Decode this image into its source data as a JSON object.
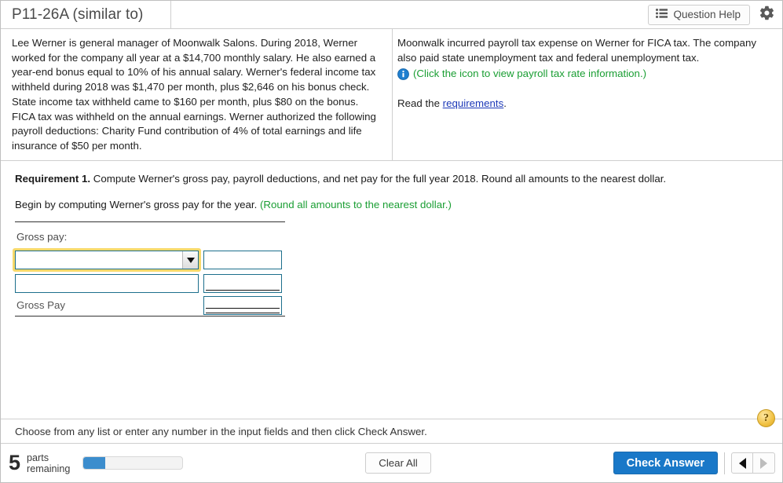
{
  "header": {
    "title": "P11-26A (similar to)",
    "question_help_label": "Question Help",
    "list_icon": "list-icon",
    "gear_icon": "gear-icon"
  },
  "problem": {
    "left_text": "Lee Werner is general manager of Moonwalk Salons. During 2018, Werner worked for the company all year at a $14,700 monthly salary. He also earned a year-end bonus equal to 10% of his annual salary. Werner's federal income tax withheld during 2018 was $1,470 per month, plus $2,646 on his bonus check. State income tax withheld came to $160 per month, plus $80 on the bonus. FICA tax was withheld on the annual earnings. Werner authorized the following payroll deductions: Charity Fund contribution of 4% of total earnings and life insurance of $50 per month.",
    "right_text": "Moonwalk incurred payroll tax expense on Werner for FICA tax. The company also paid state unemployment tax and federal unemployment tax.",
    "info_icon": "info-icon",
    "info_note": "(Click the icon to view payroll tax rate information.)",
    "read_prefix": "Read the ",
    "read_link": "requirements",
    "read_suffix": "."
  },
  "requirement": {
    "label": "Requirement 1.",
    "text": " Compute Werner's gross pay, payroll deductions, and net pay for the full year 2018. Round all amounts to the nearest dollar.",
    "begin_text": "Begin by computing Werner's gross pay for the year. ",
    "begin_note": "(Round all amounts to the nearest dollar.)"
  },
  "answer_table": {
    "caption": "Gross pay:",
    "rows": [
      {
        "type": "select",
        "value": "",
        "amount": "",
        "underline": "none"
      },
      {
        "type": "text",
        "value": "",
        "amount": "",
        "underline": "single"
      }
    ],
    "total_row": {
      "label": "Gross Pay",
      "amount": "",
      "underline": "double"
    },
    "dropdown_caret": "chevron-down-icon"
  },
  "hint": {
    "text": "Choose from any list or enter any number in the input fields and then click Check Answer.",
    "help_icon_label": "?"
  },
  "footer": {
    "parts_count": "5",
    "parts_label_line1": "parts",
    "parts_label_line2": "remaining",
    "progress_percent": 22,
    "clear_label": "Clear All",
    "check_label": "Check Answer",
    "prev_icon": "triangle-left-icon",
    "next_icon": "triangle-right-icon"
  },
  "colors": {
    "accent_blue": "#1978c8",
    "field_border": "#1d6f8c",
    "focus_gold": "#f7d96b",
    "note_green": "#1a9e33",
    "link_blue": "#1d39b8"
  }
}
